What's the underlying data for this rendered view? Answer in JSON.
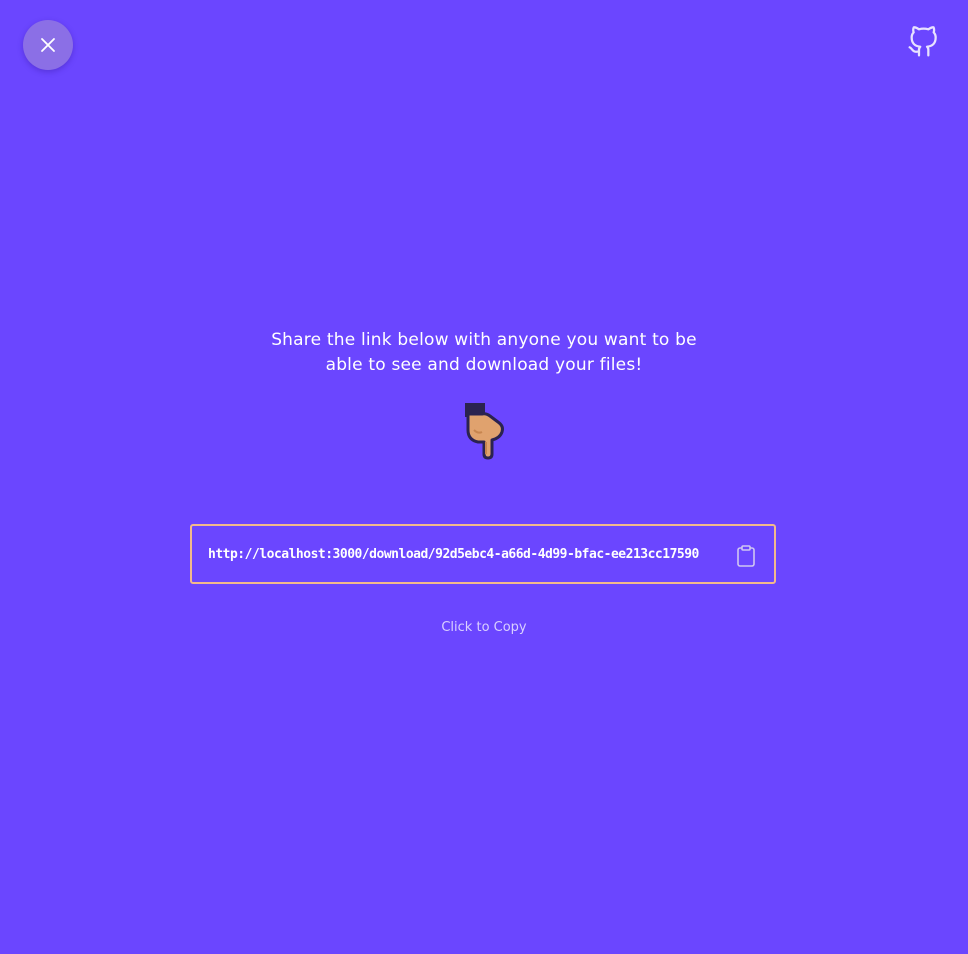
{
  "header": {
    "close_icon": "close-icon",
    "github_icon": "github-icon"
  },
  "share": {
    "message_line1": "Share the link below with anyone you want to be",
    "message_line2": "able to see and download your files!",
    "pointer_icon": "pointing-down-hand-icon",
    "link": "http://localhost:3000/download/92d5ebc4-a66d-4d99-bfac-ee213cc17590",
    "clipboard_icon": "clipboard-icon",
    "copy_hint": "Click to Copy"
  },
  "colors": {
    "background": "#6b46ff",
    "accent_border": "#f2b98b",
    "close_button": "#8b6fe6"
  }
}
